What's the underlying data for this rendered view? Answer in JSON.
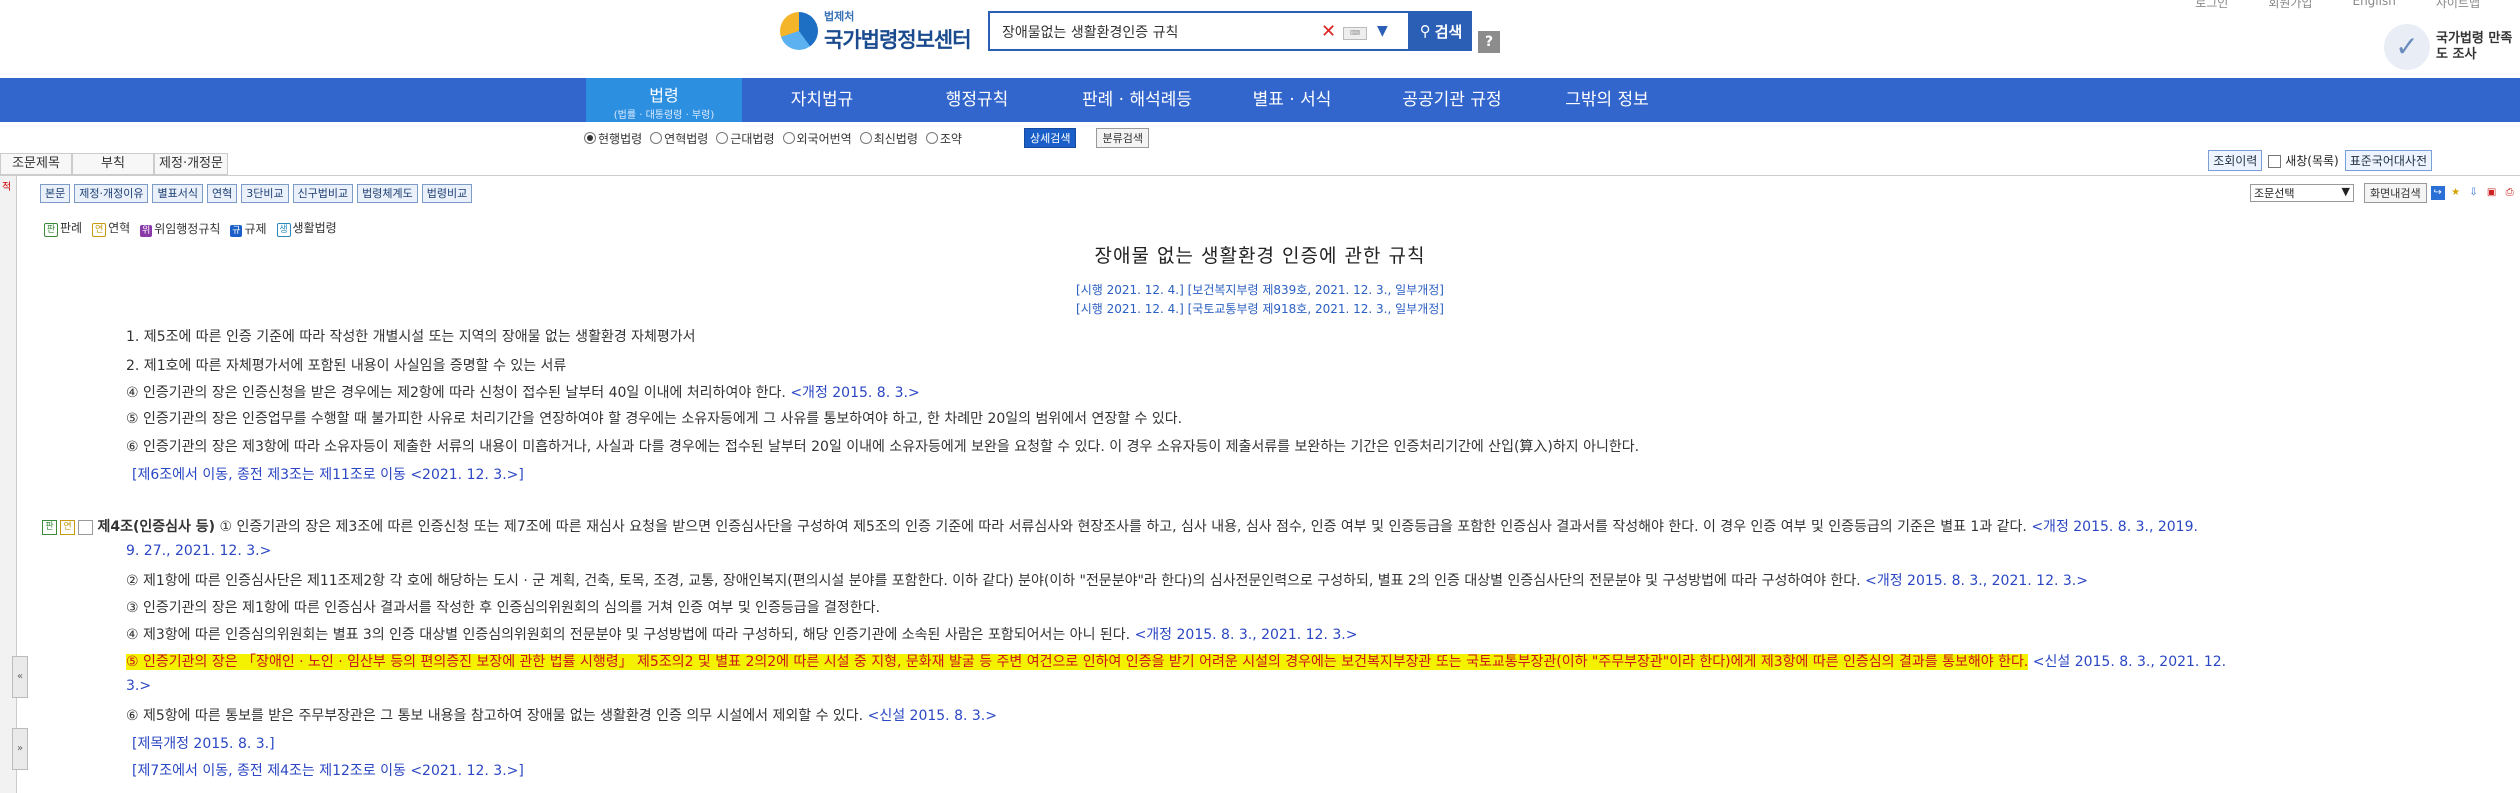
{
  "top_links": [
    "로그인",
    "회원가입",
    "English",
    "사이트맵"
  ],
  "logo": {
    "sub": "법제처",
    "main": "국가법령정보센터"
  },
  "search": {
    "value": "장애물없는 생활환경인증 규칙",
    "button": "검색",
    "help": "?"
  },
  "survey": "국가법령 만족도 조사",
  "nav": {
    "active": {
      "title": "법령",
      "sub": "(법률 · 대통령령 · 부령)"
    },
    "items": [
      "자치법규",
      "행정규칙",
      "판례 · 해석례등",
      "별표 · 서식",
      "공공기관 규정",
      "그밖의 정보"
    ]
  },
  "radios": [
    "현행법령",
    "연혁법령",
    "근대법령",
    "외국어번역",
    "최신법령",
    "조약"
  ],
  "radio_buttons": {
    "detail": "상세검색",
    "classify": "분류검색"
  },
  "subtabs": [
    "조문제목",
    "부칙",
    "제정·개정문"
  ],
  "subright": {
    "print": "조회이력",
    "new": "새창(목록)",
    "std": "표준국어대사전"
  },
  "tools": [
    "본문",
    "제정·개정이유",
    "별표서식",
    "연혁",
    "3단비교",
    "신구법비교",
    "법령체계도",
    "법령비교"
  ],
  "tool_right": {
    "select": "조문선택",
    "search": "화면내검색"
  },
  "legend": [
    {
      "icon": "판",
      "label": "판례",
      "color": "#3a8a3a"
    },
    {
      "icon": "연",
      "label": "연혁",
      "color": "#c89a10"
    },
    {
      "icon": "위",
      "label": "위임행정규칙",
      "color": "#8a3aa8"
    },
    {
      "icon": "규",
      "label": "규제",
      "color": "#1a5fc7"
    },
    {
      "icon": "생",
      "label": "생활법령",
      "color": "#2a8ac0"
    }
  ],
  "law": {
    "title": "장애물 없는 생활환경 인증에 관한 규칙",
    "amend1": "[시행 2021. 12. 4.] [보건복지부령 제839호, 2021. 12. 3., 일부개정]",
    "amend2": "[시행 2021. 12. 4.] [국토교통부령 제918호, 2021. 12. 3., 일부개정]"
  },
  "lines": {
    "l0": "1. 제5조에 따른 인증 기준에 따라 작성한 개별시설 또는 지역의 장애물 없는 생활환경 자체평가서",
    "l1": "2. 제1호에 따른 자체평가서에 포함된 내용이 사실임을 증명할 수 있는 서류",
    "l2a": "④ 인증기관의 장은 인증신청을 받은 경우에는 제2항에 따라 신청이 접수된 날부터 40일 이내에 처리하여야 한다.",
    "l2b": "<개정 2015. 8. 3.>",
    "l3": "⑤ 인증기관의 장은 인증업무를 수행할 때 불가피한 사유로 처리기간을 연장하여야 할 경우에는 소유자등에게 그 사유를 통보하여야 하고, 한 차례만 20일의 범위에서 연장할 수 있다.",
    "l4": "⑥ 인증기관의 장은 제3항에 따라 소유자등이 제출한 서류의 내용이 미흡하거나, 사실과 다를 경우에는 접수된 날부터 20일 이내에 소유자등에게 보완을 요청할 수 있다. 이 경우 소유자등이 제출서류를 보완하는 기간은 인증처리기간에 산입(算入)하지 아니한다.",
    "l5": "[제6조에서 이동, 종전 제3조는 제11조로 이동 <2021. 12. 3.>]",
    "a4_title": "제4조(인증심사 등)",
    "a4_p1": "① 인증기관의 장은 제3조에 따른 인증신청 또는 제7조에 따른 재심사 요청을 받으면 인증심사단을 구성하여 제5조의 인증 기준에 따라 서류심사와 현장조사를 하고, 심사 내용, 심사 점수, 인증 여부 및 인증등급을 포함한 인증심사 결과서를 작성해야 한다. 이 경우 인증 여부 및 인증등급의 기준은 별표 1과 같다.",
    "a4_p1d": "<개정 2015. 8. 3., 2019.",
    "a4_p1e": "9. 27., 2021. 12. 3.>",
    "a4_p2": "② 제1항에 따른 인증심사단은 제11조제2항 각 호에 해당하는 도시 · 군 계획, 건축, 토목, 조경, 교통, 장애인복지(편의시설 분야를 포함한다. 이하 같다) 분야(이하 \"전문분야\"라 한다)의 심사전문인력으로 구성하되, 별표 2의 인증 대상별 인증심사단의 전문분야 및 구성방법에 따라 구성하여야 한다.",
    "a4_p2d": "<개정 2015. 8. 3., 2021. 12. 3.>",
    "a4_p3": "③ 인증기관의 장은 제1항에 따른 인증심사 결과서를 작성한 후 인증심의위원회의 심의를 거쳐 인증 여부 및 인증등급을 결정한다.",
    "a4_p4": "④ 제3항에 따른 인증심의위원회는 별표 3의 인증 대상별 인증심의위원회의 전문분야 및 구성방법에 따라 구성하되, 해당 인증기관에 소속된 사람은 포함되어서는 아니 된다.",
    "a4_p4d": "<개정 2015. 8. 3., 2021. 12. 3.>",
    "a4_p5": "⑤ 인증기관의 장은 「장애인 · 노인 · 임산부 등의 편의증진 보장에 관한 법률 시행령」 제5조의2 및 별표 2의2에 따른 시설 중 지형, 문화재 발굴 등 주변 여건으로 인하여 인증을 받기 어려운 시설의 경우에는 보건복지부장관 또는 국토교통부장관(이하 \"주무부장관\"이라 한다)에게 제3항에 따른 인증심의 결과를 통보해야 한다.",
    "a4_p5d": "<신설 2015. 8. 3., 2021. 12.",
    "a4_p5e": "3.>",
    "a4_p6": "⑥ 제5항에 따른 통보를 받은 주무부장관은 그 통보 내용을 참고하여 장애물 없는 생활환경 인증 의무 시설에서 제외할 수 있다.",
    "a4_p6d": "<신설 2015. 8. 3.>",
    "a4_n1": "[제목개정 2015. 8. 3.]",
    "a4_n2": "[제7조에서 이동, 종전 제4조는 제12조로 이동 <2021. 12. 3.>]"
  },
  "colors": {
    "nav": "#3366cc",
    "nav_active": "#2d8fe0",
    "highlight": "#f4f200",
    "highlight_text": "#c8161d",
    "link": "#1d3aa8"
  }
}
